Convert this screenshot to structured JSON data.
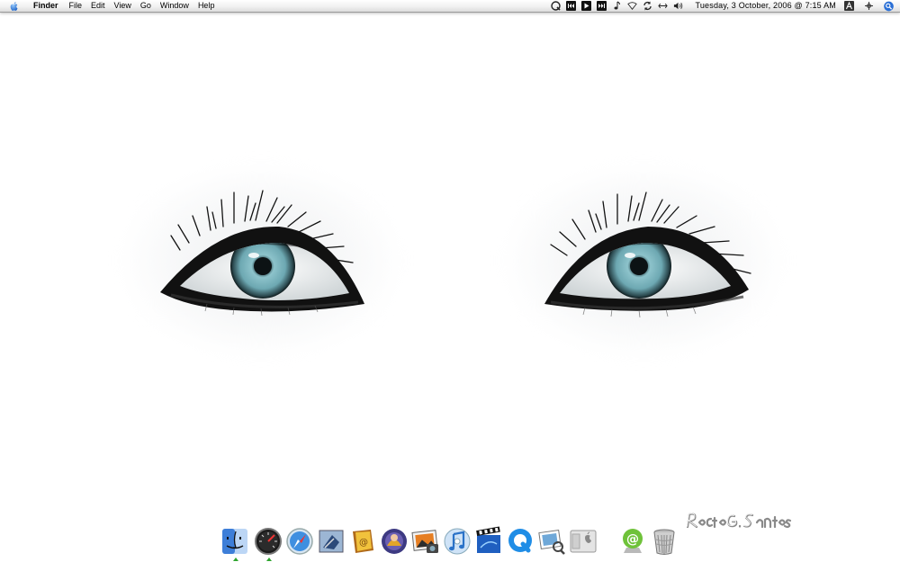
{
  "menubar": {
    "apple_icon": "apple-logo-icon",
    "app_name": "Finder",
    "menus": [
      "File",
      "Edit",
      "View",
      "Go",
      "Window",
      "Help"
    ],
    "status_icons": [
      "quicksilver-icon",
      "previous-track-icon",
      "play-icon",
      "next-track-icon",
      "music-note-icon",
      "airport-wifi-icon",
      "sync-icon",
      "arrows-icon",
      "volume-icon"
    ],
    "clock": "Tuesday, 3 October, 2006 @ 7:15 AM",
    "right_icons": [
      "input-menu-icon",
      "spaces-icon",
      "spotlight-icon"
    ]
  },
  "wallpaper": {
    "subject": "pair of blue eyes",
    "signature": "Rocio G. Santos"
  },
  "dock": {
    "items": [
      {
        "name": "Finder",
        "icon": "finder-icon",
        "running": true
      },
      {
        "name": "Dashboard",
        "icon": "dashboard-icon",
        "running": true
      },
      {
        "name": "Safari",
        "icon": "safari-icon",
        "running": false
      },
      {
        "name": "Mail",
        "icon": "mail-icon",
        "running": false
      },
      {
        "name": "Address Book",
        "icon": "address-book-icon",
        "running": false
      },
      {
        "name": "iChat",
        "icon": "ichat-icon",
        "running": false
      },
      {
        "name": "iPhoto",
        "icon": "iphoto-icon",
        "running": false
      },
      {
        "name": "iTunes",
        "icon": "itunes-icon",
        "running": false
      },
      {
        "name": "iMovie",
        "icon": "imovie-icon",
        "running": false
      },
      {
        "name": "QuickTime Player",
        "icon": "quicktime-icon",
        "running": false
      },
      {
        "name": "Preview",
        "icon": "preview-icon",
        "running": false
      },
      {
        "name": "System Preferences",
        "icon": "system-preferences-icon",
        "running": false
      },
      {
        "name": "Mail Stack",
        "icon": "at-sign-icon",
        "running": false
      },
      {
        "name": "Trash",
        "icon": "trash-icon",
        "running": false
      }
    ]
  },
  "colors": {
    "menubar": "#eeeeee",
    "background": "#ffffff",
    "iris": "#7fb6bf",
    "running_indicator": "#2fa52f"
  }
}
